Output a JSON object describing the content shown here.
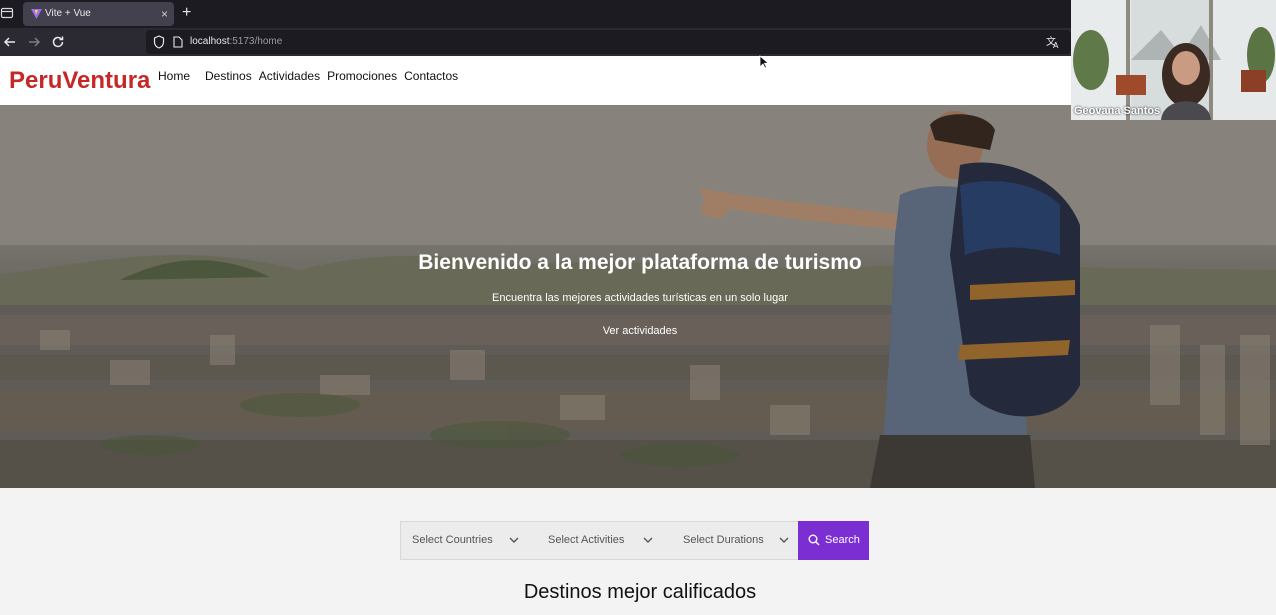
{
  "browser": {
    "tab_title": "Vite + Vue",
    "tab_close": "×",
    "new_tab": "+",
    "url_host": "localhost",
    "url_rest": ":5173/home"
  },
  "site": {
    "logo": "PeruVentura",
    "menu": [
      "Home",
      "Destinos",
      "Actividades",
      "Promociones",
      "Contactos"
    ]
  },
  "hero": {
    "title": "Bienvenido a la mejor plataforma de turismo",
    "subtitle": "Encuentra las mejores actividades turísticas en un solo lugar",
    "link": "Ver actividades"
  },
  "search": {
    "countries": "Select Countries",
    "activities": "Select Activities",
    "durations": "Select Durations",
    "button": "Search"
  },
  "section": {
    "title": "Destinos mejor calificados"
  },
  "video": {
    "participant": "Geovana Santos"
  },
  "colors": {
    "logo": "#c62828",
    "search_button": "#7b2fd3"
  }
}
